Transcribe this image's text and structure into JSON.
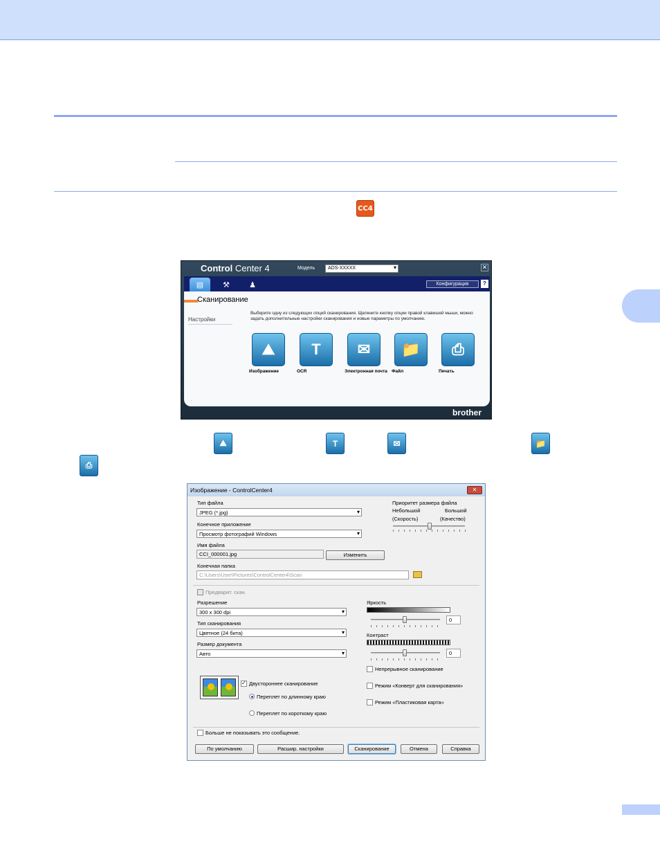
{
  "document": {
    "chapter_icon_text": "CC4"
  },
  "controlcenter": {
    "logo_bold": "Control",
    "logo_light": "Center 4",
    "model_label": "Модель",
    "model_value": "ADS-XXXXX",
    "close_glyph": "✕",
    "config_button": "Конфигурация",
    "help": "?",
    "section_title": "Сканирование",
    "sidebar_item": "Настройки",
    "description": "Выберите одну из следующих опций сканирования. Щелкните кнопку опции правой клавишей мыши, можно задать дополнительные настройки сканирования и новые параметры по умолчанию.",
    "buttons": [
      {
        "label": "Изображение",
        "icon": "image-icon"
      },
      {
        "label": "OCR",
        "icon": "ocr-icon"
      },
      {
        "label": "Электронная почта",
        "icon": "email-icon"
      },
      {
        "label": "Файл",
        "icon": "folder-icon"
      },
      {
        "label": "Печать",
        "icon": "print-icon"
      }
    ],
    "brand": "brother"
  },
  "dialog": {
    "title": "Изображение - ControlCenter4",
    "close_glyph": "✕",
    "file_type_label": "Тип файла",
    "file_type_value": "JPEG (*.jpg)",
    "target_app_label": "Конечное приложение",
    "target_app_value": "Просмотр фотографий Windows",
    "file_name_label": "Имя файла",
    "file_name_value": "CCI_000001.jpg",
    "change_button": "Изменить",
    "dest_folder_label": "Конечная папка",
    "dest_folder_value": "C:\\Users\\User\\Pictures\\ControlCenter4\\Scan",
    "priority_label": "Приоритет размера файла",
    "priority_small": "Небольшой",
    "priority_small_sub": "(Скорость)",
    "priority_large": "Большой",
    "priority_large_sub": "(Качество)",
    "prescan_label": "Предварит. скан.",
    "resolution_label": "Разрешение",
    "resolution_value": "300 x 300 dpi",
    "scan_type_label": "Тип сканирования",
    "scan_type_value": "Цветное (24 бита)",
    "doc_size_label": "Размер документа",
    "doc_size_value": "Авто",
    "brightness_label": "Яркость",
    "brightness_value": "0",
    "contrast_label": "Контраст",
    "contrast_value": "0",
    "duplex_label": "Двустороннее сканирование",
    "binding_long": "Переплет по длинному краю",
    "binding_short": "Переплет по короткому краю",
    "continuous_label": "Непрерывное сканирование",
    "carrier_label": "Режим «Конверт для сканирования»",
    "plastic_label": "Режим «Пластиковая карта»",
    "dont_show_label": "Больше не показывать это сообщение.",
    "default_button": "По умолчанию",
    "advanced_button": "Расшир. настройки",
    "scan_button": "Сканирование",
    "cancel_button": "Отмена",
    "help_button": "Справка"
  },
  "colors": {
    "header": "#cfe0fd",
    "rule": "#8fa9ee",
    "accent_orange": "#e55a1c",
    "tile_blue": "#1b6ea8"
  }
}
